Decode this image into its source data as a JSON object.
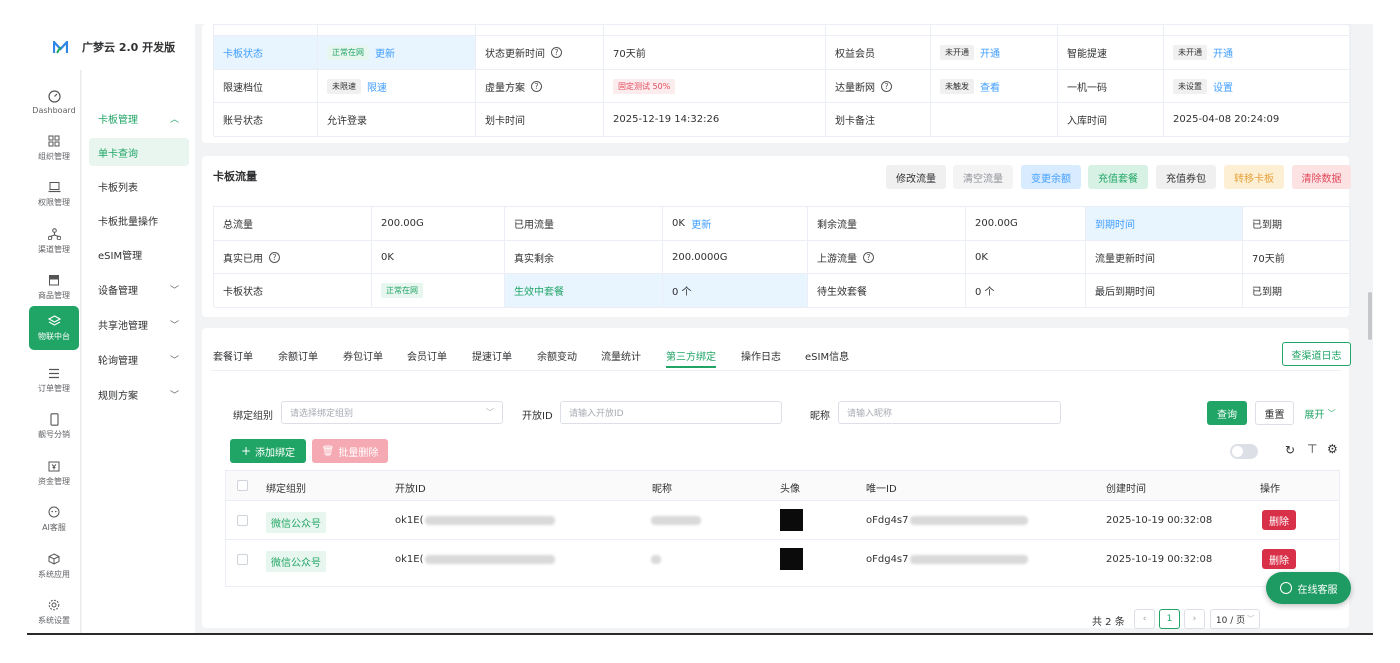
{
  "app": {
    "title": "广梦云 2.0 开发版"
  },
  "rail": [
    {
      "label": "Dashboard",
      "icon": "gauge-icon"
    },
    {
      "label": "组织管理",
      "icon": "grid-icon"
    },
    {
      "label": "权限管理",
      "icon": "laptop-icon"
    },
    {
      "label": "渠道管理",
      "icon": "network-icon"
    },
    {
      "label": "商品管理",
      "icon": "store-icon"
    },
    {
      "label": "物联中台",
      "icon": "hub-icon",
      "active": true
    },
    {
      "label": "订单管理",
      "icon": "list-icon"
    },
    {
      "label": "靓号分销",
      "icon": "phone-icon"
    },
    {
      "label": "资金管理",
      "icon": "wallet-icon"
    },
    {
      "label": "AI客服",
      "icon": "bot-icon"
    },
    {
      "label": "系统应用",
      "icon": "cube-icon"
    },
    {
      "label": "系统设置",
      "icon": "gear-icon"
    }
  ],
  "submenu": {
    "parent": "卡板管理",
    "children": [
      "单卡查询",
      "卡板列表",
      "卡板批量操作"
    ],
    "others": [
      "eSIM管理",
      "设备管理",
      "共享池管理",
      "轮询管理",
      "规则方案"
    ]
  },
  "status_grid": {
    "row1": {
      "k1": "卡板状态",
      "tag1": "正常在网",
      "link1": "更新",
      "k2": "状态更新时间",
      "v2": "70天前",
      "k3": "权益会员",
      "tag3": "未开通",
      "link3": "开通",
      "k4": "智能提速",
      "tag4": "未开通",
      "link4": "开通"
    },
    "row2": {
      "k1": "限速档位",
      "tag1": "未限速",
      "link1": "限速",
      "k2": "虚量方案",
      "tag2": "固定测试 50%",
      "k3": "达量断网",
      "tag3": "未触发",
      "link3": "查看",
      "k4": "一机一码",
      "tag4": "未设置",
      "link4": "设置"
    },
    "row3": {
      "k1": "账号状态",
      "v1": "允许登录",
      "k2": "划卡时间",
      "v2": "2025-12-19 14:32:26",
      "k3": "划卡备注",
      "v3": "",
      "k4": "入库时间",
      "v4": "2025-04-08 20:24:09"
    }
  },
  "flow": {
    "title": "卡板流量",
    "buttons": [
      "修改流量",
      "清空流量",
      "变更余额",
      "充值套餐",
      "充值券包",
      "转移卡板",
      "清除数据"
    ],
    "row1": {
      "k1": "总流量",
      "v1": "200.00G",
      "k2": "已用流量",
      "v2": "0K",
      "link2": "更新",
      "k3": "剩余流量",
      "v3": "200.00G",
      "k4": "到期时间",
      "v4": "已到期"
    },
    "row2": {
      "k1": "真实已用",
      "v1": "0K",
      "k2": "真实剩余",
      "v2": "200.0000G",
      "k3": "上游流量",
      "v3": "0K",
      "k4": "流量更新时间",
      "v4": "70天前"
    },
    "row3": {
      "k1": "卡板状态",
      "tag1": "正常在网",
      "k2": "生效中套餐",
      "v2": "0 个",
      "k3": "待生效套餐",
      "v3": "0 个",
      "k4": "最后到期时间",
      "v4": "已到期"
    }
  },
  "tabs": [
    "套餐订单",
    "余额订单",
    "券包订单",
    "会员订单",
    "提速订单",
    "余额变动",
    "流量统计",
    "第三方绑定",
    "操作日志",
    "eSIM信息"
  ],
  "channel_log_button": "查渠道日志",
  "filter": {
    "group_label": "绑定组别",
    "group_placeholder": "请选择绑定组别",
    "openid_label": "开放ID",
    "openid_placeholder": "请输入开放ID",
    "nick_label": "昵称",
    "nick_placeholder": "请输入昵称",
    "query": "查询",
    "reset": "重置",
    "expand": "展开"
  },
  "actions": {
    "add": "添加绑定",
    "batch_delete": "批量删除"
  },
  "table": {
    "headers": [
      "绑定组别",
      "开放ID",
      "昵称",
      "头像",
      "唯一ID",
      "创建时间",
      "操作"
    ],
    "rows": [
      {
        "group": "微信公众号",
        "openid_prefix": "ok1E(",
        "uid_prefix": "oFdg4s7",
        "created": "2025-10-19 00:32:08",
        "action": "删除"
      },
      {
        "group": "微信公众号",
        "openid_prefix": "ok1E(",
        "uid_prefix": "oFdg4s7",
        "created": "2025-10-19 00:32:08",
        "action": "删除"
      }
    ]
  },
  "pagination": {
    "total": "共 2 条",
    "current": "1",
    "page_size": "10 / 页"
  },
  "online_service": "在线客服",
  "colors": {
    "primary": "#21a566",
    "link": "#409eff",
    "danger": "#d9304a"
  }
}
